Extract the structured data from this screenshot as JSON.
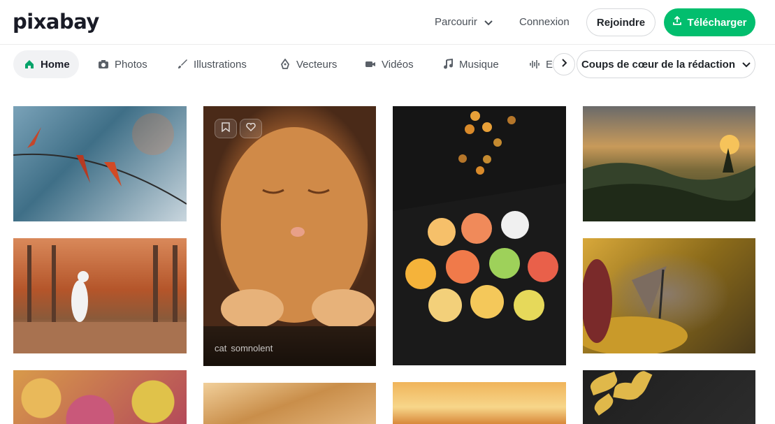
{
  "header": {
    "logo": "pixabay",
    "browse_label": "Parcourir",
    "login_label": "Connexion",
    "join_label": "Rejoindre",
    "upload_label": "Télécharger"
  },
  "categories": [
    {
      "label": "Home",
      "icon": "home-icon",
      "active": true
    },
    {
      "label": "Photos",
      "icon": "camera-icon"
    },
    {
      "label": "Illustrations",
      "icon": "brush-icon"
    },
    {
      "label": "Vecteurs",
      "icon": "pen-nib-icon"
    },
    {
      "label": "Vidéos",
      "icon": "video-camera-icon"
    },
    {
      "label": "Musique",
      "icon": "music-note-icon"
    },
    {
      "label": "Ef",
      "icon": "sound-wave-icon"
    }
  ],
  "sort": {
    "selected": "Coups de cœur de la rédaction"
  },
  "hovered_tile": {
    "tags": [
      "cat",
      "somnolent"
    ]
  },
  "colors": {
    "accent": "#02be6e",
    "text": "#4a5058"
  }
}
